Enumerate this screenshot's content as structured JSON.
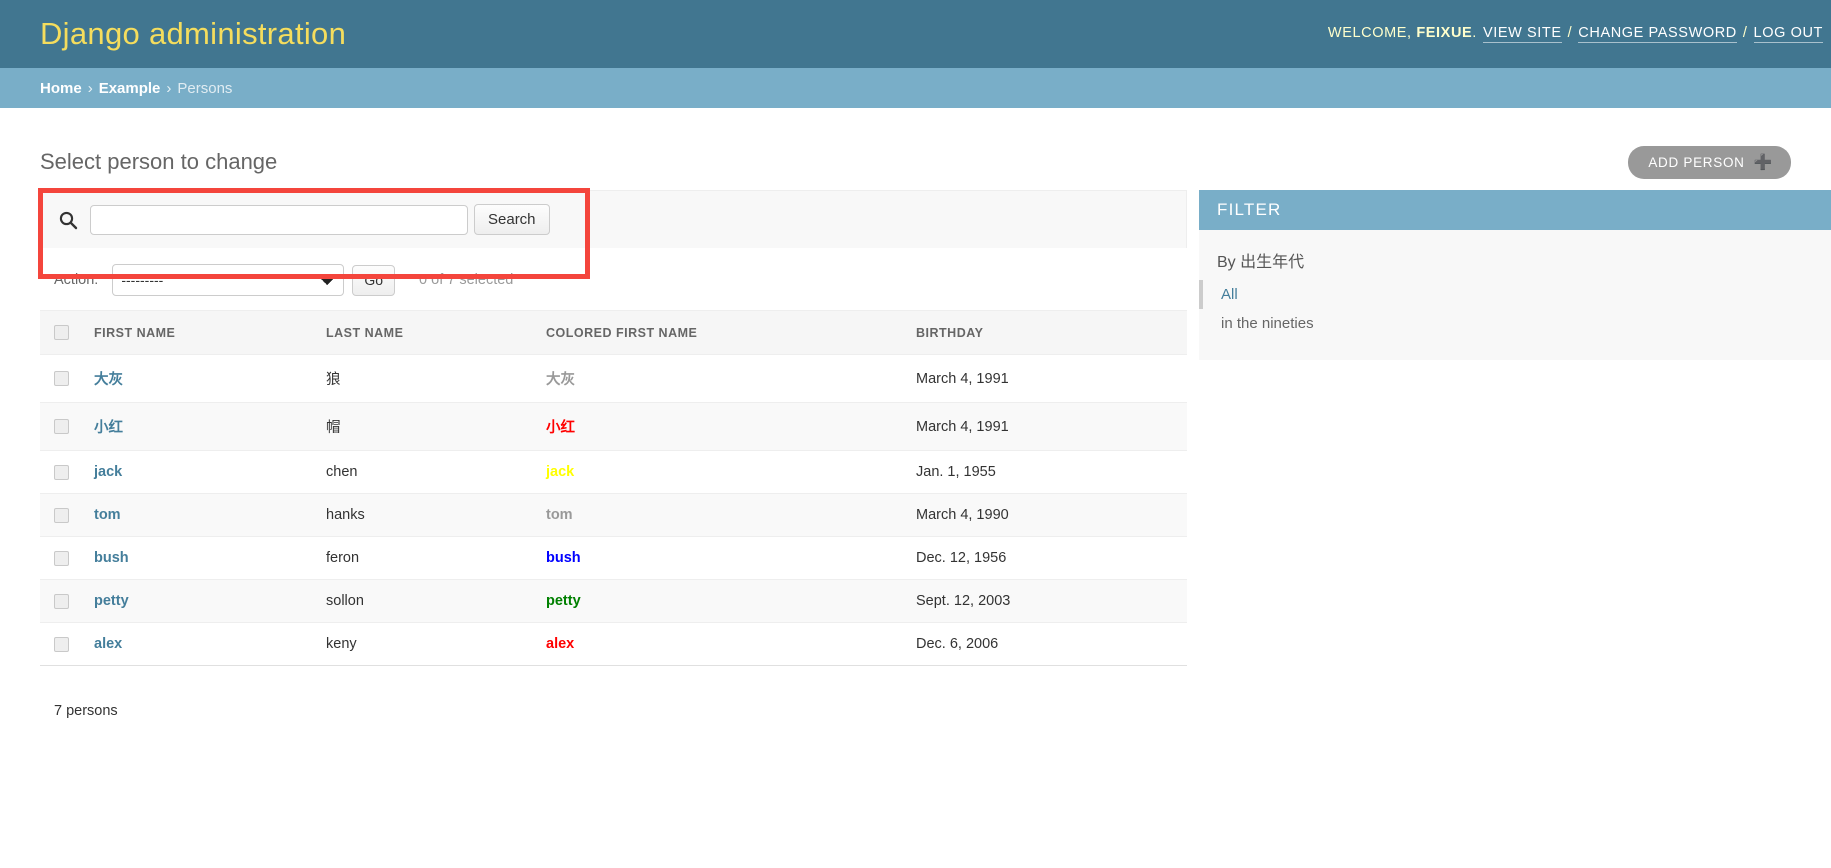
{
  "header": {
    "site_name": "Django administration",
    "welcome_word": "WELCOME,",
    "username": "FEIXUE",
    "period": ".",
    "links": [
      {
        "label": "VIEW SITE",
        "name": "view-site-link"
      },
      {
        "label": "CHANGE PASSWORD",
        "name": "change-password-link"
      },
      {
        "label": "LOG OUT",
        "name": "log-out-link"
      }
    ],
    "separator": "/"
  },
  "breadcrumbs": {
    "home": "Home",
    "app": "Example",
    "current": "Persons",
    "separator": "›"
  },
  "content": {
    "page_title": "Select person to change",
    "add_button_label": "ADD PERSON",
    "add_button_icon": "plus-icon"
  },
  "search": {
    "value": "",
    "placeholder": "",
    "submit_label": "Search",
    "icon": "search-icon"
  },
  "actions": {
    "label": "Action:",
    "selected_option": "---------",
    "options": [
      "---------"
    ],
    "go_label": "Go",
    "counter": "0 of 7 selected"
  },
  "table": {
    "columns": [
      "FIRST NAME",
      "LAST NAME",
      "COLORED FIRST NAME",
      "BIRTHDAY"
    ],
    "rows": [
      {
        "first_name": "大灰",
        "last_name": "狼",
        "colored_first_name": "大灰",
        "colored_color": "#999999",
        "birthday": "March 4, 1991"
      },
      {
        "first_name": "小红",
        "last_name": "帽",
        "colored_first_name": "小红",
        "colored_color": "#ff0000",
        "birthday": "March 4, 1991"
      },
      {
        "first_name": "jack",
        "last_name": "chen",
        "colored_first_name": "jack",
        "colored_color": "#ffff00",
        "birthday": "Jan. 1, 1955"
      },
      {
        "first_name": "tom",
        "last_name": "hanks",
        "colored_first_name": "tom",
        "colored_color": "#999999",
        "birthday": "March 4, 1990"
      },
      {
        "first_name": "bush",
        "last_name": "feron",
        "colored_first_name": "bush",
        "colored_color": "#0000ff",
        "birthday": "Dec. 12, 1956"
      },
      {
        "first_name": "petty",
        "last_name": "sollon",
        "colored_first_name": "petty",
        "colored_color": "#008000",
        "birthday": "Sept. 12, 2003"
      },
      {
        "first_name": "alex",
        "last_name": "keny",
        "colored_first_name": "alex",
        "colored_color": "#ff0000",
        "birthday": "Dec. 6, 2006"
      }
    ],
    "result_count": "7 persons"
  },
  "filter": {
    "title": "FILTER",
    "group_label": "By 出生年代",
    "items": [
      {
        "label": "All",
        "selected": true
      },
      {
        "label": "in the nineties",
        "selected": false
      }
    ]
  },
  "colors": {
    "header_bg": "#417690",
    "breadcrumb_bg": "#79aec8",
    "brand_yellow": "#f5dd5d",
    "link_blue": "#447e9b",
    "annotation_red": "#f4453c"
  }
}
